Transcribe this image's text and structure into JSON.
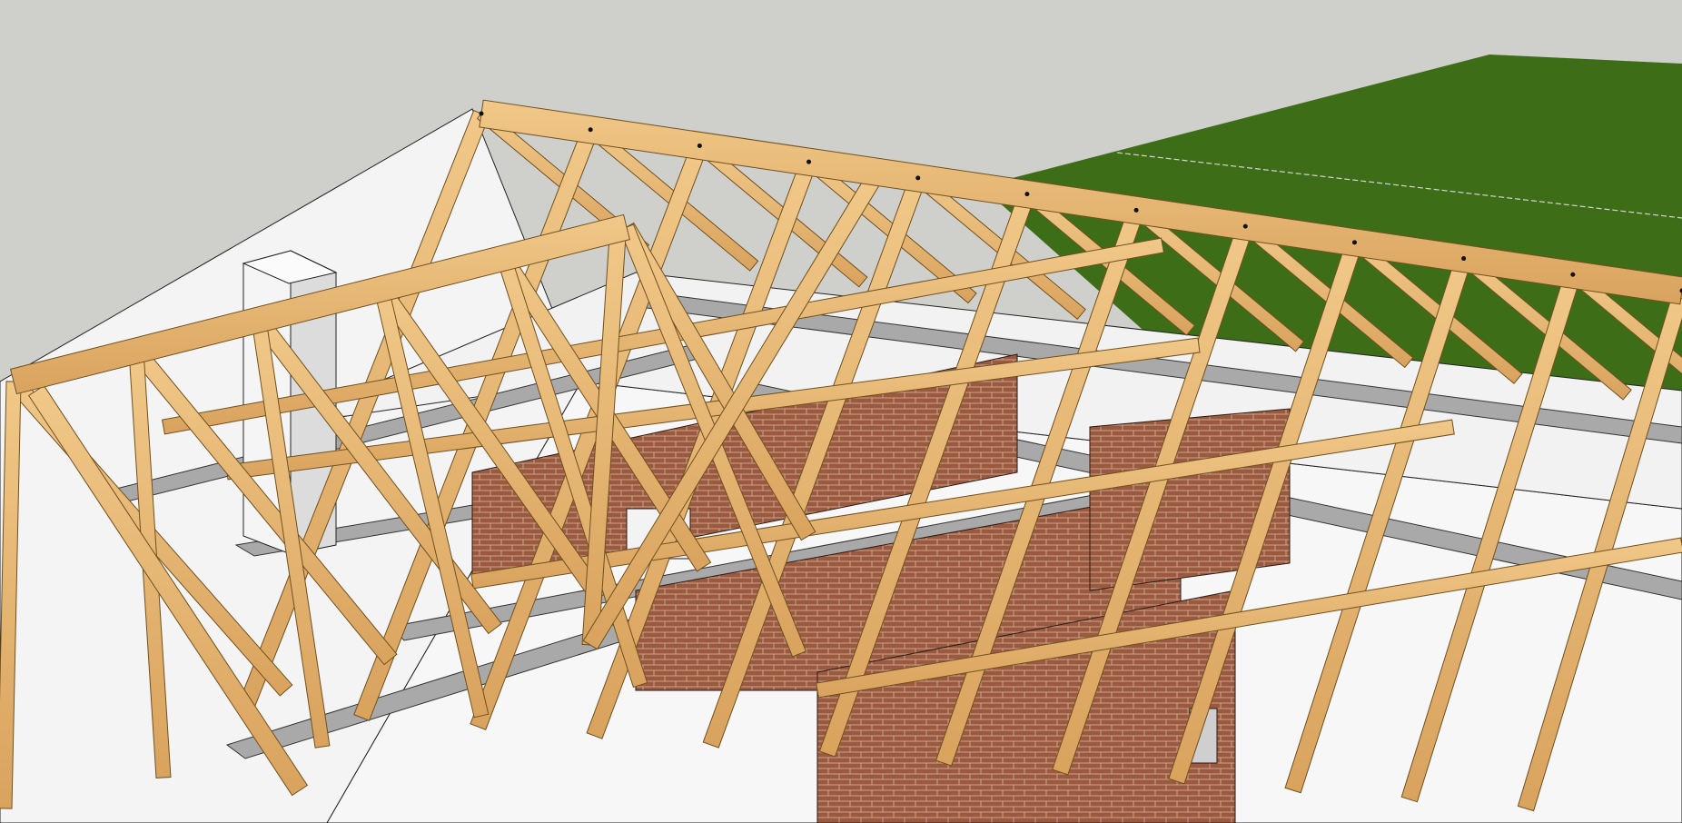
{
  "scene": {
    "kind": "3d-model-viewport",
    "subject": "roof-truss-framing",
    "colors": {
      "sky": "#cfcfcb",
      "ground": "#3e6d17",
      "ground_dark": "#2f5a10",
      "wall": "#f2f2f2",
      "wall_shade": "#d9d9d9",
      "beam": "#a9a9a9",
      "timber": "#e8bb74",
      "timber_dark": "#c89550",
      "timber_edge": "#6f5020",
      "brick": "#9b5a40",
      "brick_mortar": "#c9a48c",
      "outline": "#111111"
    }
  }
}
